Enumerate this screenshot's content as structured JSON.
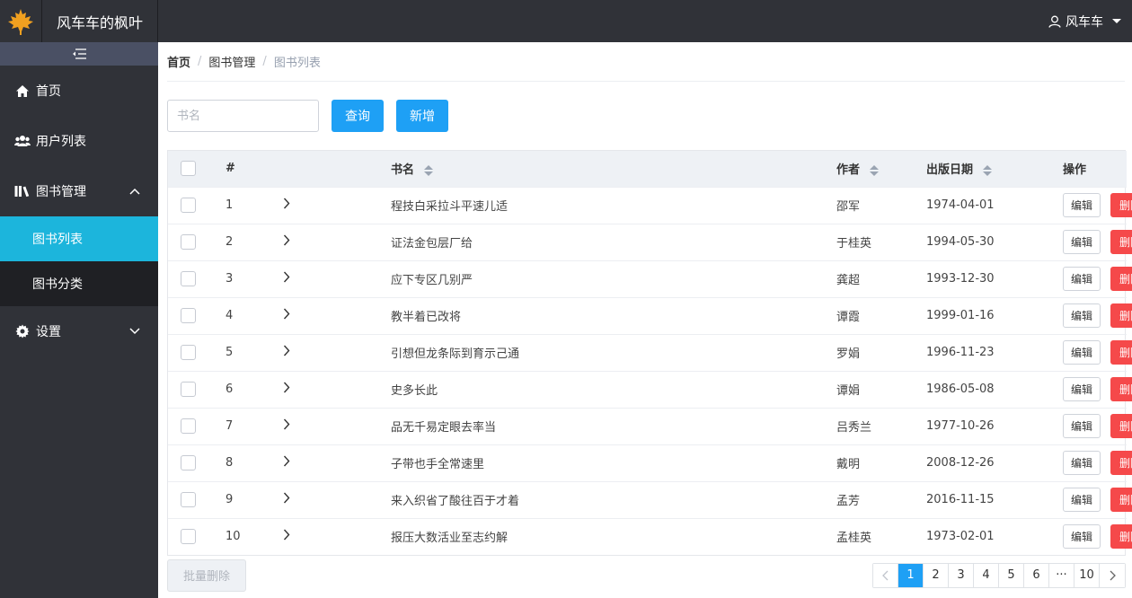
{
  "header": {
    "brand": "风车车的枫叶",
    "username": "风车车"
  },
  "sidebar": {
    "items": [
      {
        "label": "首页",
        "icon": "home-icon"
      },
      {
        "label": "用户列表",
        "icon": "users-icon"
      },
      {
        "label": "图书管理",
        "icon": "library-icon",
        "expanded": true,
        "children": [
          {
            "label": "图书列表",
            "active": true
          },
          {
            "label": "图书分类",
            "active": false
          }
        ]
      },
      {
        "label": "设置",
        "icon": "gear-icon",
        "expanded": false
      }
    ]
  },
  "breadcrumb": [
    "首页",
    "图书管理",
    "图书列表"
  ],
  "toolbar": {
    "search_placeholder": "书名",
    "search_value": "",
    "query_label": "查询",
    "add_label": "新增"
  },
  "table": {
    "columns": [
      "#",
      "书名",
      "作者",
      "出版日期",
      "操作"
    ],
    "edit_label": "编辑",
    "delete_label": "删除",
    "rows": [
      {
        "index": "1",
        "title": "程技白采拉斗平速儿适",
        "author": "邵军",
        "date": "1974-04-01"
      },
      {
        "index": "2",
        "title": "证法金包层厂给",
        "author": "于桂英",
        "date": "1994-05-30"
      },
      {
        "index": "3",
        "title": "应下专区几别严",
        "author": "龚超",
        "date": "1993-12-30"
      },
      {
        "index": "4",
        "title": "教半着已改将",
        "author": "谭霞",
        "date": "1999-01-16"
      },
      {
        "index": "5",
        "title": "引想但龙条际到育示己通",
        "author": "罗娟",
        "date": "1996-11-23"
      },
      {
        "index": "6",
        "title": "史多长此",
        "author": "谭娟",
        "date": "1986-05-08"
      },
      {
        "index": "7",
        "title": "品无千易定眼去率当",
        "author": "吕秀兰",
        "date": "1977-10-26"
      },
      {
        "index": "8",
        "title": "子带也手全常速里",
        "author": "戴明",
        "date": "2008-12-26"
      },
      {
        "index": "9",
        "title": "来入织省了酸往百于才着",
        "author": "孟芳",
        "date": "2016-11-15"
      },
      {
        "index": "10",
        "title": "报压大数活业至志约解",
        "author": "孟桂英",
        "date": "1973-02-01"
      }
    ]
  },
  "footer": {
    "batch_delete_label": "批量删除",
    "pages": [
      "1",
      "2",
      "3",
      "4",
      "5",
      "6",
      "···",
      "10"
    ],
    "current_page": "1"
  },
  "colors": {
    "sidebar_bg": "#303238",
    "active_menu": "#1cb5dc",
    "primary": "#1ea0f5",
    "danger": "#f5494a"
  }
}
